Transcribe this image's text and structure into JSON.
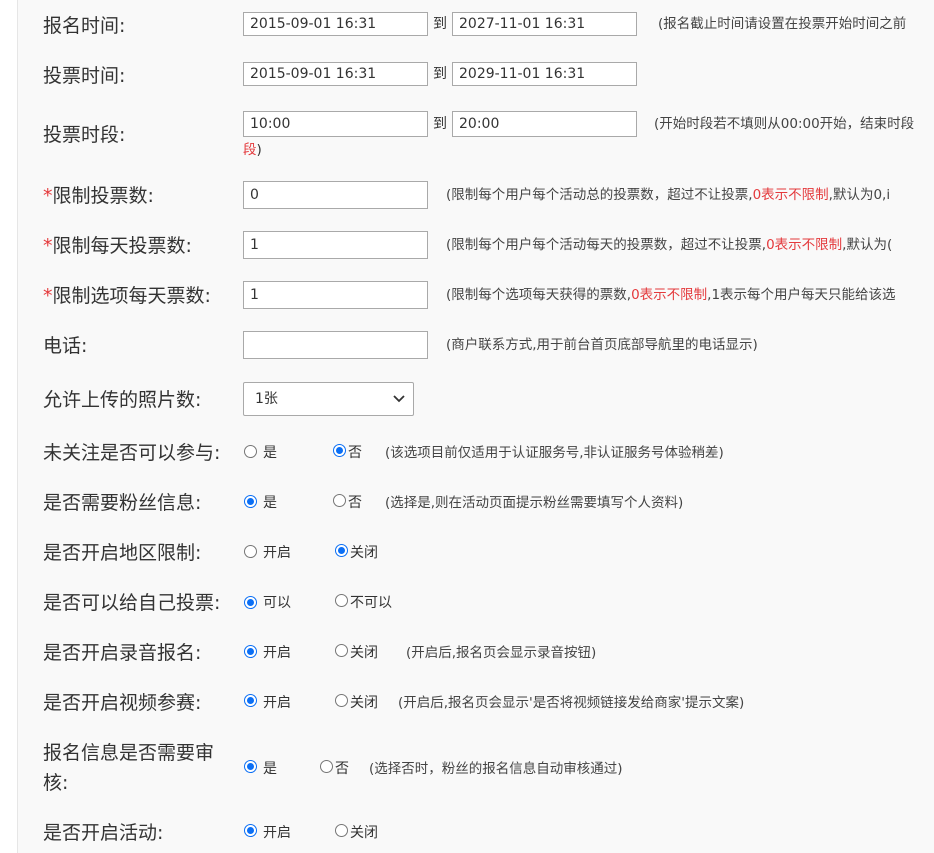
{
  "rows": {
    "signup_time": {
      "label": "报名时间:",
      "start": "2015-09-01 16:31",
      "to": "到",
      "end": "2027-11-01 16:31",
      "hint": "(报名截止时间请设置在投票开始时间之前"
    },
    "vote_time": {
      "label": "投票时间:",
      "start": "2015-09-01 16:31",
      "to": "到",
      "end": "2029-11-01 16:31"
    },
    "vote_period": {
      "label": "投票时段:",
      "start": "10:00",
      "to": "到",
      "end": "20:00",
      "hint": "(开始时段若不填则从00:00开始，结束时段",
      "hint_cont_red": "段",
      "hint_cont_black": ")"
    },
    "limit_votes": {
      "required": "*",
      "label": "限制投票数:",
      "value": "0",
      "hint_pre": "(限制每个用户每个活动总的投票数，超过不让投票,",
      "hint_red": "0表示不限制",
      "hint_post": ",默认为0,i"
    },
    "limit_daily": {
      "required": "*",
      "label": "限制每天投票数:",
      "value": "1",
      "hint_pre": "(限制每个用户每个活动每天的投票数，超过不让投票,",
      "hint_red": "0表示不限制",
      "hint_post": ",默认为("
    },
    "limit_option": {
      "required": "*",
      "label": "限制选项每天票数:",
      "value": "1",
      "hint_pre": "(限制每个选项每天获得的票数,",
      "hint_red": "0表示不限制",
      "hint_post": ",1表示每个用户每天只能给该选"
    },
    "phone": {
      "label": "电话:",
      "value": "",
      "hint": "(商户联系方式,用于前台首页底部导航里的电话显示)"
    },
    "photos": {
      "label": "允许上传的照片数:",
      "selected": "1张"
    },
    "unfollow": {
      "label": "未关注是否可以参与:",
      "opt1": "是",
      "opt2": "否",
      "selected": "opt2",
      "hint": "(该选项目前仅适用于认证服务号,非认证服务号体验稍差)"
    },
    "fans_info": {
      "label": "是否需要粉丝信息:",
      "opt1": "是",
      "opt2": "否",
      "selected": "opt1",
      "hint": "(选择是,则在活动页面提示粉丝需要填写个人资料)"
    },
    "region": {
      "label": "是否开启地区限制:",
      "opt1": "开启",
      "opt2": "关闭",
      "selected": "opt2"
    },
    "self_vote": {
      "label": "是否可以给自己投票:",
      "opt1": "可以",
      "opt2": "不可以",
      "selected": "opt1"
    },
    "audio": {
      "label": "是否开启录音报名:",
      "opt1": "开启",
      "opt2": "关闭",
      "selected": "opt1",
      "hint": "(开启后,报名页会显示录音按钮)"
    },
    "video": {
      "label": "是否开启视频参赛:",
      "opt1": "开启",
      "opt2": "关闭",
      "selected": "opt1",
      "hint": "(开启后,报名页会显示'是否将视频链接发给商家'提示文案)"
    },
    "audit": {
      "label": "报名信息是否需要审核:",
      "opt1": "是",
      "opt2": "否",
      "selected": "opt1",
      "hint": "(选择否时，粉丝的报名信息自动审核通过)"
    },
    "activity": {
      "label": "是否开启活动:",
      "opt1": "开启",
      "opt2": "关闭",
      "selected": "opt1"
    }
  }
}
